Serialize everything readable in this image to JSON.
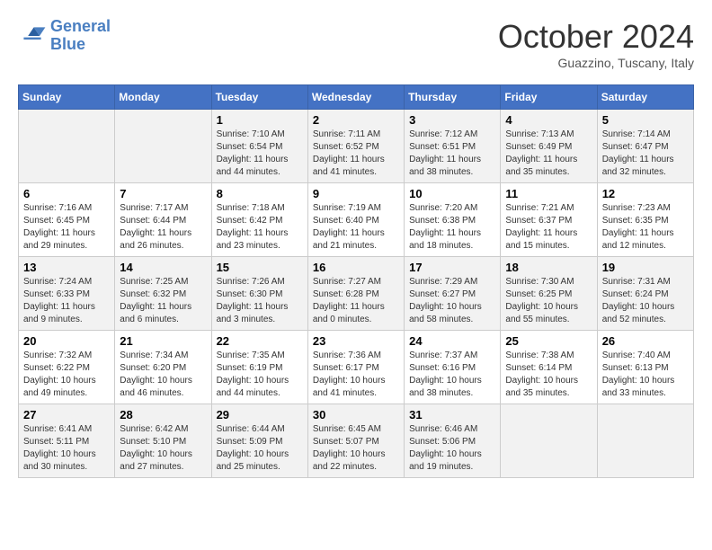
{
  "logo": {
    "line1": "General",
    "line2": "Blue"
  },
  "title": "October 2024",
  "subtitle": "Guazzino, Tuscany, Italy",
  "days_of_week": [
    "Sunday",
    "Monday",
    "Tuesday",
    "Wednesday",
    "Thursday",
    "Friday",
    "Saturday"
  ],
  "weeks": [
    [
      {
        "day": "",
        "info": ""
      },
      {
        "day": "",
        "info": ""
      },
      {
        "day": "1",
        "info": "Sunrise: 7:10 AM\nSunset: 6:54 PM\nDaylight: 11 hours and 44 minutes."
      },
      {
        "day": "2",
        "info": "Sunrise: 7:11 AM\nSunset: 6:52 PM\nDaylight: 11 hours and 41 minutes."
      },
      {
        "day": "3",
        "info": "Sunrise: 7:12 AM\nSunset: 6:51 PM\nDaylight: 11 hours and 38 minutes."
      },
      {
        "day": "4",
        "info": "Sunrise: 7:13 AM\nSunset: 6:49 PM\nDaylight: 11 hours and 35 minutes."
      },
      {
        "day": "5",
        "info": "Sunrise: 7:14 AM\nSunset: 6:47 PM\nDaylight: 11 hours and 32 minutes."
      }
    ],
    [
      {
        "day": "6",
        "info": "Sunrise: 7:16 AM\nSunset: 6:45 PM\nDaylight: 11 hours and 29 minutes."
      },
      {
        "day": "7",
        "info": "Sunrise: 7:17 AM\nSunset: 6:44 PM\nDaylight: 11 hours and 26 minutes."
      },
      {
        "day": "8",
        "info": "Sunrise: 7:18 AM\nSunset: 6:42 PM\nDaylight: 11 hours and 23 minutes."
      },
      {
        "day": "9",
        "info": "Sunrise: 7:19 AM\nSunset: 6:40 PM\nDaylight: 11 hours and 21 minutes."
      },
      {
        "day": "10",
        "info": "Sunrise: 7:20 AM\nSunset: 6:38 PM\nDaylight: 11 hours and 18 minutes."
      },
      {
        "day": "11",
        "info": "Sunrise: 7:21 AM\nSunset: 6:37 PM\nDaylight: 11 hours and 15 minutes."
      },
      {
        "day": "12",
        "info": "Sunrise: 7:23 AM\nSunset: 6:35 PM\nDaylight: 11 hours and 12 minutes."
      }
    ],
    [
      {
        "day": "13",
        "info": "Sunrise: 7:24 AM\nSunset: 6:33 PM\nDaylight: 11 hours and 9 minutes."
      },
      {
        "day": "14",
        "info": "Sunrise: 7:25 AM\nSunset: 6:32 PM\nDaylight: 11 hours and 6 minutes."
      },
      {
        "day": "15",
        "info": "Sunrise: 7:26 AM\nSunset: 6:30 PM\nDaylight: 11 hours and 3 minutes."
      },
      {
        "day": "16",
        "info": "Sunrise: 7:27 AM\nSunset: 6:28 PM\nDaylight: 11 hours and 0 minutes."
      },
      {
        "day": "17",
        "info": "Sunrise: 7:29 AM\nSunset: 6:27 PM\nDaylight: 10 hours and 58 minutes."
      },
      {
        "day": "18",
        "info": "Sunrise: 7:30 AM\nSunset: 6:25 PM\nDaylight: 10 hours and 55 minutes."
      },
      {
        "day": "19",
        "info": "Sunrise: 7:31 AM\nSunset: 6:24 PM\nDaylight: 10 hours and 52 minutes."
      }
    ],
    [
      {
        "day": "20",
        "info": "Sunrise: 7:32 AM\nSunset: 6:22 PM\nDaylight: 10 hours and 49 minutes."
      },
      {
        "day": "21",
        "info": "Sunrise: 7:34 AM\nSunset: 6:20 PM\nDaylight: 10 hours and 46 minutes."
      },
      {
        "day": "22",
        "info": "Sunrise: 7:35 AM\nSunset: 6:19 PM\nDaylight: 10 hours and 44 minutes."
      },
      {
        "day": "23",
        "info": "Sunrise: 7:36 AM\nSunset: 6:17 PM\nDaylight: 10 hours and 41 minutes."
      },
      {
        "day": "24",
        "info": "Sunrise: 7:37 AM\nSunset: 6:16 PM\nDaylight: 10 hours and 38 minutes."
      },
      {
        "day": "25",
        "info": "Sunrise: 7:38 AM\nSunset: 6:14 PM\nDaylight: 10 hours and 35 minutes."
      },
      {
        "day": "26",
        "info": "Sunrise: 7:40 AM\nSunset: 6:13 PM\nDaylight: 10 hours and 33 minutes."
      }
    ],
    [
      {
        "day": "27",
        "info": "Sunrise: 6:41 AM\nSunset: 5:11 PM\nDaylight: 10 hours and 30 minutes."
      },
      {
        "day": "28",
        "info": "Sunrise: 6:42 AM\nSunset: 5:10 PM\nDaylight: 10 hours and 27 minutes."
      },
      {
        "day": "29",
        "info": "Sunrise: 6:44 AM\nSunset: 5:09 PM\nDaylight: 10 hours and 25 minutes."
      },
      {
        "day": "30",
        "info": "Sunrise: 6:45 AM\nSunset: 5:07 PM\nDaylight: 10 hours and 22 minutes."
      },
      {
        "day": "31",
        "info": "Sunrise: 6:46 AM\nSunset: 5:06 PM\nDaylight: 10 hours and 19 minutes."
      },
      {
        "day": "",
        "info": ""
      },
      {
        "day": "",
        "info": ""
      }
    ]
  ]
}
